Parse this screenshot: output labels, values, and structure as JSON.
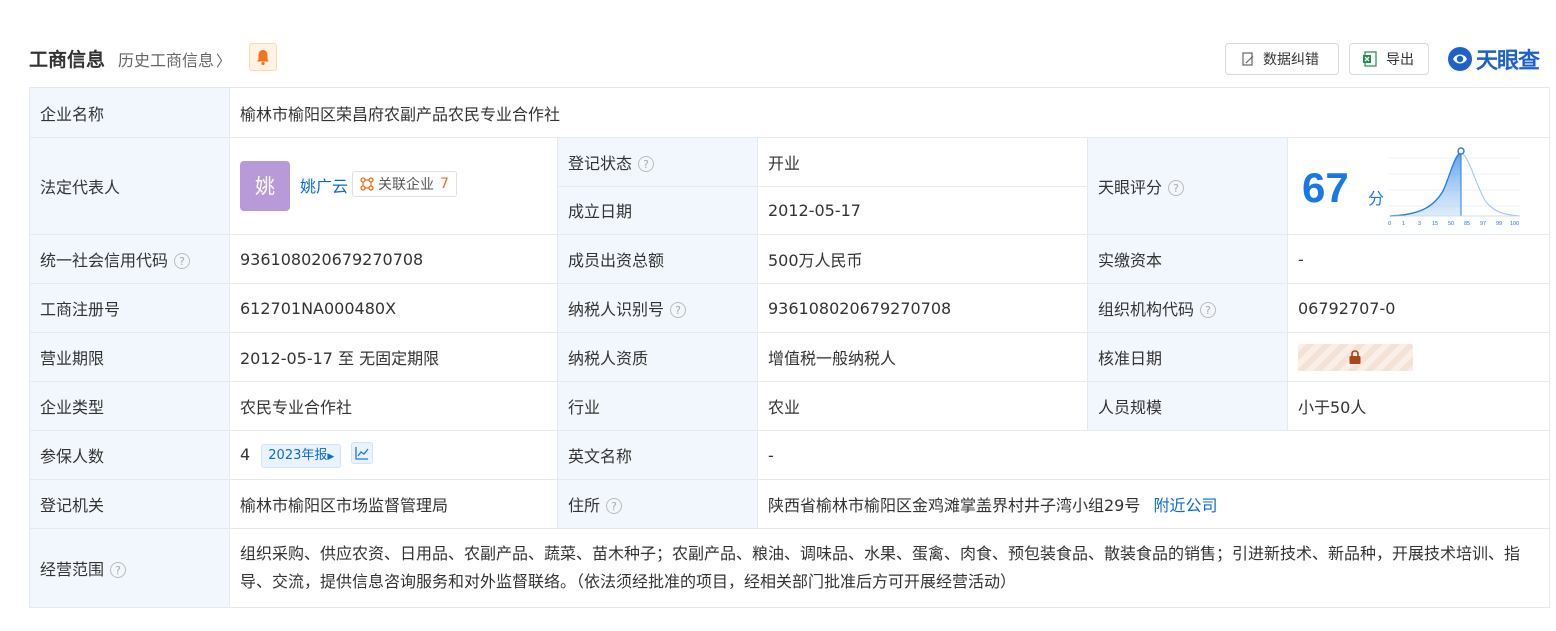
{
  "header": {
    "title": "工商信息",
    "history_link": "历史工商信息",
    "buttons": {
      "correct": "数据纠错",
      "export": "导出"
    },
    "logo_text": "天眼查",
    "brand_color": "#1d61c9"
  },
  "company": {
    "name_label": "企业名称",
    "name": "榆林市榆阳区荣昌府农副产品农民专业合作社",
    "legal_rep_label": "法定代表人",
    "legal_rep_avatar": "姚",
    "legal_rep_name": "姚广云",
    "related_label": "关联企业",
    "related_count": "7",
    "reg_status_label": "登记状态",
    "reg_status": "开业",
    "found_date_label": "成立日期",
    "found_date": "2012-05-17",
    "tianyan_score_label": "天眼评分",
    "score": "67",
    "score_unit": "分",
    "score_axis": [
      "0",
      "1",
      "3",
      "15",
      "50",
      "85",
      "97",
      "99",
      "100"
    ],
    "credit_code_label": "统一社会信用代码",
    "credit_code": "936108020679270708",
    "capital_label": "成员出资总额",
    "capital": "500万人民币",
    "paid_capital_label": "实缴资本",
    "paid_capital": "-",
    "reg_no_label": "工商注册号",
    "reg_no": "612701NA000480X",
    "taxpayer_id_label": "纳税人识别号",
    "taxpayer_id": "936108020679270708",
    "org_code_label": "组织机构代码",
    "org_code": "06792707-0",
    "term_label": "营业期限",
    "term": "2012-05-17 至 无固定期限",
    "tax_qual_label": "纳税人资质",
    "tax_qual": "增值税一般纳税人",
    "approve_date_label": "核准日期",
    "type_label": "企业类型",
    "type": "农民专业合作社",
    "industry_label": "行业",
    "industry": "农业",
    "staff_label": "人员规模",
    "staff": "小于50人",
    "insured_label": "参保人数",
    "insured": "4",
    "report_tag": "2023年报",
    "english_name_label": "英文名称",
    "english_name": "-",
    "authority_label": "登记机关",
    "authority": "榆林市榆阳区市场监督管理局",
    "address_label": "住所",
    "address": "陕西省榆林市榆阳区金鸡滩掌盖界村井子湾小组29号",
    "nearby_link": "附近公司",
    "scope_label": "经营范围",
    "scope": "组织采购、供应农资、日用品、农副产品、蔬菜、苗木种子；农副产品、粮油、调味品、水果、蛋禽、肉食、预包装食品、散装食品的销售；引进新技术、新品种，开展技术培训、指导、交流，提供信息咨询服务和对外监督联络。（依法须经批准的项目，经相关部门批准后方可开展经营活动）"
  }
}
